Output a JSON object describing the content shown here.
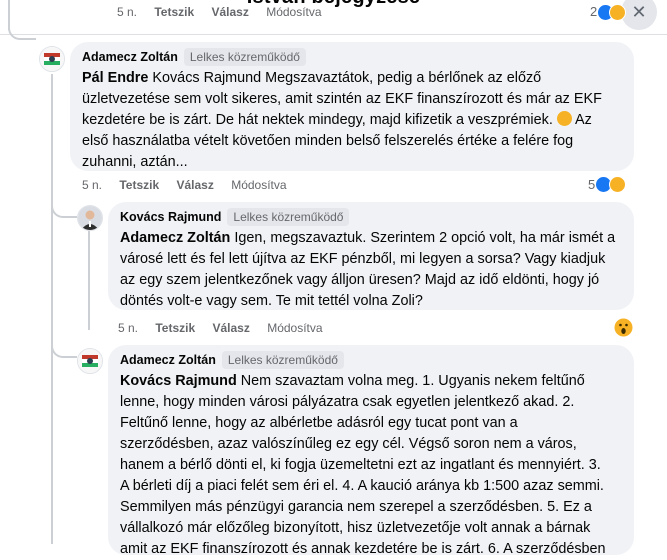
{
  "header": {
    "title": "István bejegyzése",
    "close_icon": "close-icon"
  },
  "top_comment_meta": {
    "time": "5 n.",
    "like": "Tetszik",
    "reply": "Válasz",
    "edited": "Módosítva",
    "count": "2"
  },
  "comments": [
    {
      "author": "Adamecz Zoltán",
      "badge": "Lelkes közreműködő",
      "tag": "Pál Endre",
      "text": " Kovács Rajmund Megszavaztátok, pedig a bérlőnek az előző\nüzletvezetése sem volt sikeres, amit szintén az EKF finanszírozott és már az EKF\nkezdetére be is zárt. De hát nektek mindegy, majd kifizetik a veszprémiek. ",
      "text2": " Az\nelső használatba vételt követően minden belső felszerelés értéke a felére fog\nzuhanni, aztán...",
      "time": "5 n.",
      "like": "Tetszik",
      "reply": "Válasz",
      "edited": "Módosítva",
      "reaction_count": "5"
    },
    {
      "author": "Kovács Rajmund",
      "badge": "Lelkes közreműködő",
      "tag": "Adamecz Zoltán",
      "text": " Igen, megszavaztuk. Szerintem 2 opció volt, ha már ismét a\nvárosé lett és fel lett újítva az EKF pénzből, mi legyen a sorsa? Vagy kiadjuk\naz egy szem jelentkezőnek vagy álljon üresen? Majd az idő eldönti, hogy jó\ndöntés volt-e vagy sem. Te mit tettél volna Zoli?",
      "time": "5 n.",
      "like": "Tetszik",
      "reply": "Válasz",
      "edited": "Módosítva"
    },
    {
      "author": "Adamecz Zoltán",
      "badge": "Lelkes közreműködő",
      "tag": "Kovács Rajmund",
      "text": " Nem szavaztam volna meg. 1. Ugyanis nekem feltűnő\nlenne, hogy minden városi pályázatra csak egyetlen jelentkező akad. 2.\nFeltűnő lenne, hogy az albérletbe adásról egy tucat pont van a\nszerződésben, azaz valószínűleg ez egy cél. Végső soron nem a város,\nhanem a bérlő dönti el, ki fogja üzemeltetni ezt az ingatlant és mennyiért. 3.\nA bérleti díj a piaci felét sem éri el. 4. A kaució aránya kb 1:500 azaz semmi.\nSemmilyen más pénzügyi garancia nem szerepel a szerződésben. 5. Ez a\nvállalkozó már előzőleg bizonyított, hisz üzletvezetője volt annak a bárnak\namit az EKF finanszírozott és annak kezdetére be is zárt. 6. A szerződésben"
    }
  ],
  "colors": {
    "bubble": "#f0f2f5",
    "secondary_text": "#65676b",
    "like_blue": "#1877f2",
    "emoji_yellow": "#f7b125"
  }
}
